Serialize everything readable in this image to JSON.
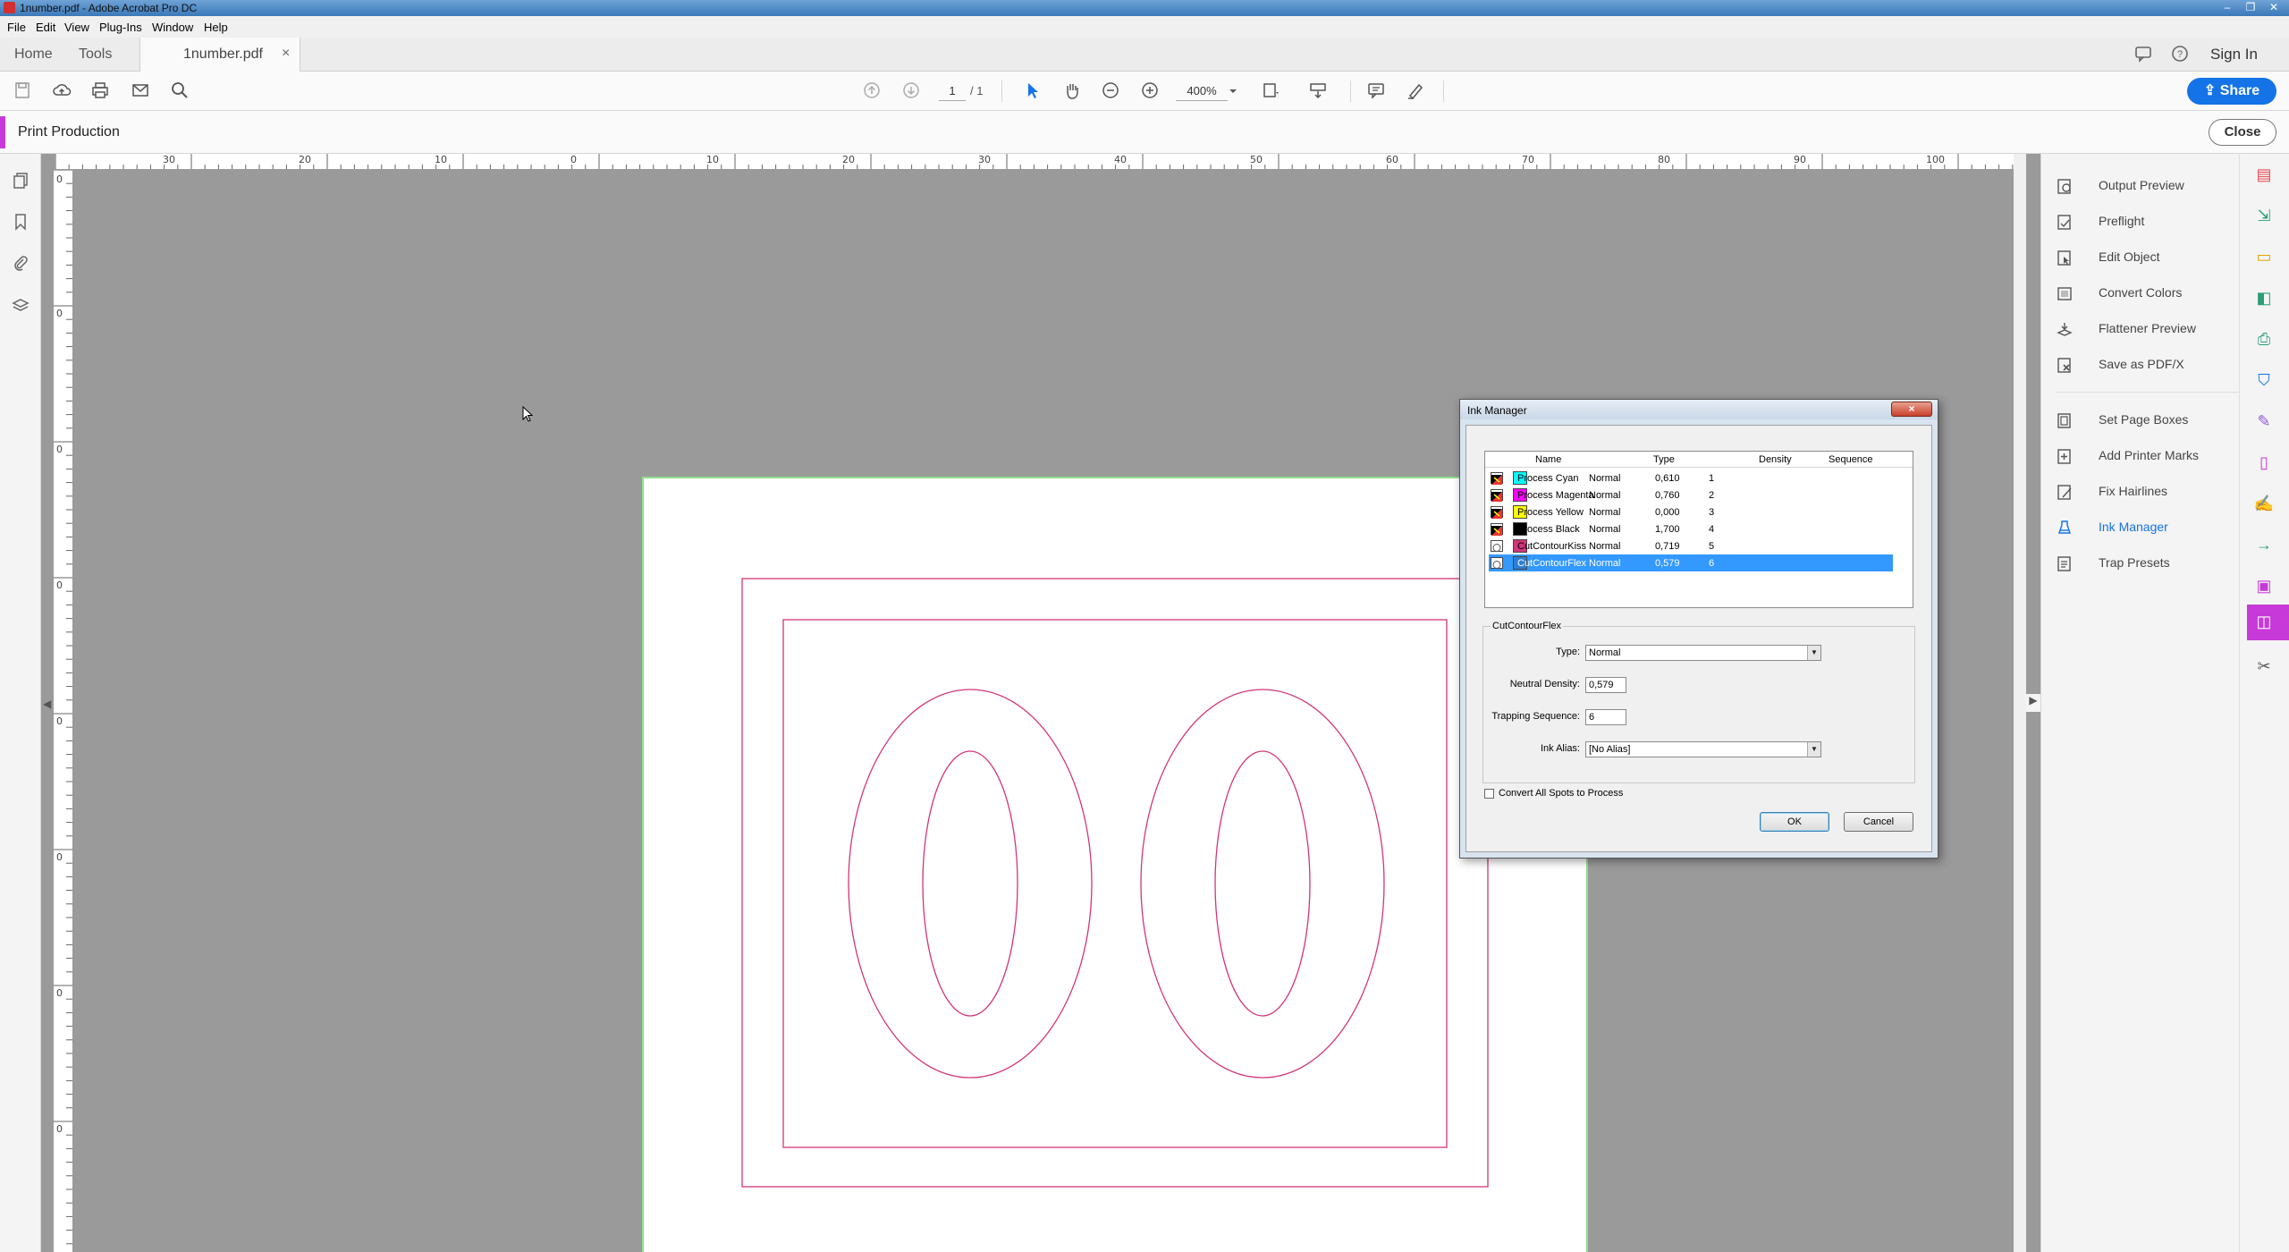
{
  "window": {
    "title": "1number.pdf - Adobe Acrobat Pro DC"
  },
  "menu": [
    "File",
    "Edit",
    "View",
    "Plug-Ins",
    "Window",
    "Help"
  ],
  "tabs": {
    "home": "Home",
    "tools": "Tools",
    "document": "1number.pdf",
    "close_glyph": "×",
    "sign_in": "Sign In"
  },
  "toolbar": {
    "page_current": "1",
    "page_total": "/ 1",
    "zoom": "400%",
    "share": "Share"
  },
  "print_production": {
    "title": "Print Production",
    "close": "Close"
  },
  "ruler": {
    "horizontal": [
      "30",
      "20",
      "10",
      "0",
      "10",
      "20",
      "30",
      "40",
      "50",
      "60",
      "70",
      "80",
      "90",
      "100"
    ],
    "vertical": [
      "0",
      "0",
      "0",
      "0",
      "0",
      "0",
      "0",
      "0"
    ]
  },
  "right_panel": {
    "items": [
      "Output Preview",
      "Preflight",
      "Edit Object",
      "Convert Colors",
      "Flattener Preview",
      "Save as PDF/X",
      "Set Page Boxes",
      "Add Printer Marks",
      "Fix Hairlines",
      "Ink Manager",
      "Trap Presets"
    ],
    "active": "Ink Manager"
  },
  "ink_manager": {
    "title": "Ink Manager",
    "close_glyph": "×",
    "columns": {
      "name": "Name",
      "type": "Type",
      "density": "Density",
      "sequence": "Sequence"
    },
    "inks": [
      {
        "name": "Process Cyan",
        "type": "Normal",
        "density": "0,610",
        "sequence": "1",
        "color": "#00ffff"
      },
      {
        "name": "Process Magenta",
        "type": "Normal",
        "density": "0,760",
        "sequence": "2",
        "color": "#ff00ff"
      },
      {
        "name": "Process Yellow",
        "type": "Normal",
        "density": "0,000",
        "sequence": "3",
        "color": "#ffff00"
      },
      {
        "name": "Process Black",
        "type": "Normal",
        "density": "1,700",
        "sequence": "4",
        "color": "#000000"
      },
      {
        "name": "CutContourKiss",
        "type": "Normal",
        "density": "0,719",
        "sequence": "5",
        "color": "#d2357a"
      },
      {
        "name": "CutContourFlex",
        "type": "Normal",
        "density": "0,579",
        "sequence": "6",
        "color": "#2d7fd4"
      }
    ],
    "selected_index": 5,
    "detail": {
      "group_title": "CutContourFlex",
      "type_label": "Type:",
      "type_value": "Normal",
      "density_label": "Neutral Density:",
      "density_value": "0,579",
      "sequence_label": "Trapping Sequence:",
      "sequence_value": "6",
      "alias_label": "Ink Alias:",
      "alias_value": "[No Alias]"
    },
    "convert_all_label": "Convert All Spots to Process",
    "convert_all_checked": false,
    "ok": "OK",
    "cancel": "Cancel"
  },
  "artwork": {
    "stroke_color": "#d2357a",
    "page_border_color": "#8ee08e"
  }
}
